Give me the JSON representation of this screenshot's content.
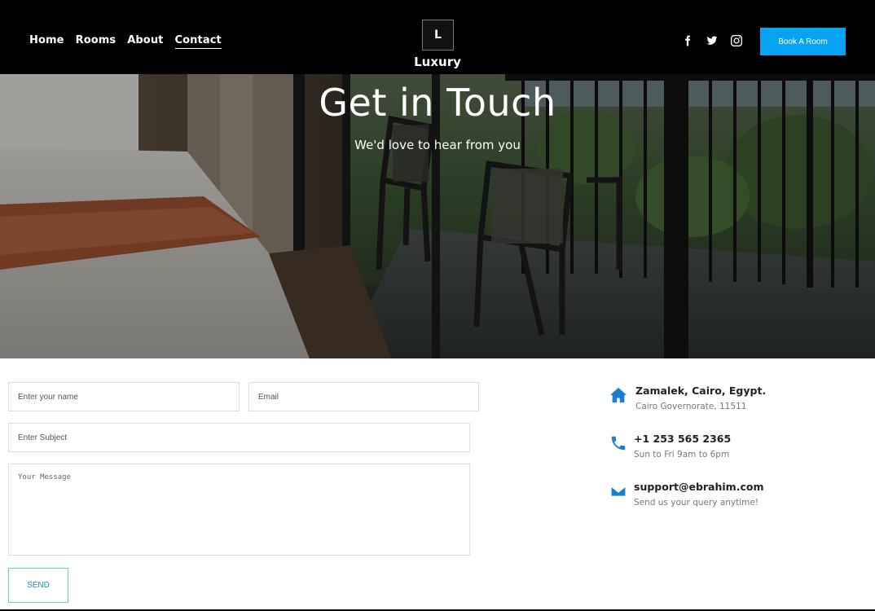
{
  "nav": {
    "items": [
      {
        "label": "Home",
        "active": false
      },
      {
        "label": "Rooms",
        "active": false
      },
      {
        "label": "About",
        "active": false
      },
      {
        "label": "Contact",
        "active": true
      }
    ]
  },
  "logo": {
    "mark": "L",
    "name": "Luxury"
  },
  "socials": [
    "facebook-icon",
    "twitter-icon",
    "instagram-icon"
  ],
  "header": {
    "book_label": "Book A Room",
    "accent": "#06a3f2"
  },
  "hero": {
    "title": "Get in Touch",
    "subtitle": "We'd love to hear from you"
  },
  "form": {
    "name_placeholder": "Enter your name",
    "email_placeholder": "Email",
    "subject_placeholder": "Enter Subject",
    "message_placeholder": "Your Message",
    "send_label": "SEND"
  },
  "contact": {
    "address": {
      "icon": "home-icon",
      "title": "Zamalek, Cairo, Egypt.",
      "sub": "Cairo Governorate, 11511"
    },
    "phone": {
      "icon": "phone-icon",
      "title": "+1 253 565 2365",
      "sub": "Sun to Fri 9am to 6pm"
    },
    "email": {
      "icon": "mail-icon",
      "title": "support@ebrahim.com",
      "sub": "Send us your query anytime!"
    }
  }
}
